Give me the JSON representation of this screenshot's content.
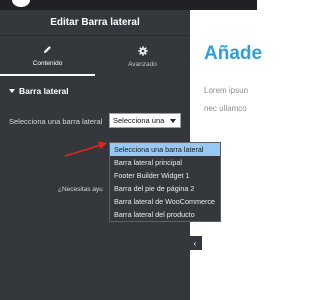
{
  "panel": {
    "title": "Editar Barra lateral",
    "tabs": [
      {
        "label": "Contenido",
        "icon": "pencil-icon"
      },
      {
        "label": "Avanzado",
        "icon": "gear-icon"
      }
    ],
    "section_title": "Barra lateral",
    "control_label": "Selecciona una barra lateral",
    "select_value": "Selecciona una",
    "help_text": "¿Necesitas ayu"
  },
  "dropdown": {
    "options": [
      "Selecciona una barra lateral",
      "Barra lateral principal",
      "Footer Builder Widget 1",
      "Barra del pie de página 2",
      "Barra lateral de WooCommerce",
      "Barra lateral del producto"
    ],
    "selected_index": 0
  },
  "content": {
    "title": "Añade",
    "line1": "Lorem ipsun",
    "line2": "nec ullamco"
  },
  "colors": {
    "panel_bg": "#34383c",
    "accent_title": "#2ea0d8",
    "selected_option": "#98c8f3",
    "pointer_arrow": "#e0261f"
  }
}
